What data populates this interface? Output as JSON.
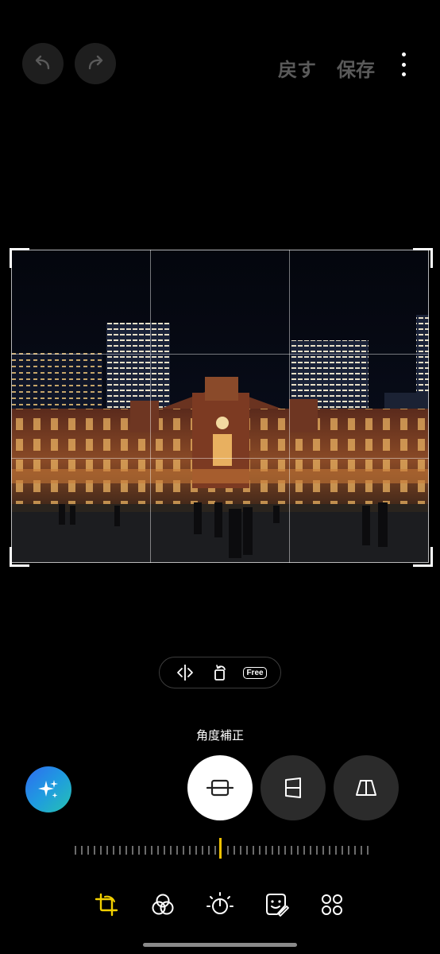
{
  "header": {
    "undo_icon": "undo-icon",
    "redo_icon": "redo-icon",
    "revert_label": "戻す",
    "save_label": "保存",
    "more_icon": "more-vertical-icon"
  },
  "crop_tools": {
    "flip_icon": "flip-horizontal-icon",
    "rotate_icon": "rotate-icon",
    "free_label": "Free"
  },
  "mode": {
    "label": "角度補正",
    "ai_icon": "sparkle-icon",
    "options": [
      "straighten-icon",
      "vertical-perspective-icon",
      "horizontal-perspective-icon"
    ],
    "selected": 0,
    "straighten_angle": 0
  },
  "tabs": [
    "crop-icon",
    "filter-icon",
    "tone-icon",
    "sticker-icon",
    "more-tools-icon"
  ],
  "colors": {
    "accent": "#f2c200",
    "selected_tab": "#f2d000",
    "ai_gradient_start": "#2f6bf0",
    "ai_gradient_end": "#26c2b0"
  }
}
